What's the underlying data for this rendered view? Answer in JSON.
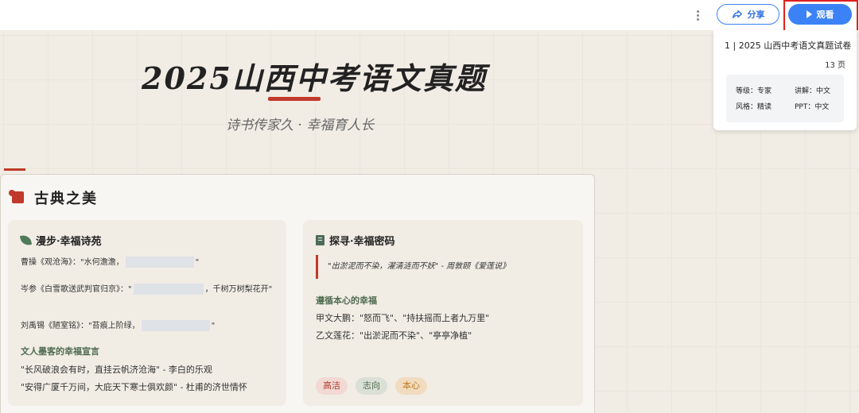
{
  "toolbar": {
    "more_icon": "kebab-vertical-icon",
    "share_label": "分享",
    "share_icon": "share-arrow-icon",
    "watch_label": "观看",
    "watch_icon": "play-icon",
    "accent_color": "#3b82f6",
    "highlight_color": "#e02020"
  },
  "slide": {
    "title": "2025山西中考语文真题",
    "subtitle": "诗书传家久 · 幸福育人长",
    "section": {
      "icon": "scroll-icon",
      "title": "古典之美"
    },
    "left_panel": {
      "icon": "leaf-icon",
      "title": "漫步·幸福诗苑",
      "poems": [
        {
          "before": "曹操《观沧海》：\"水何澹澹，",
          "after": "\""
        },
        {
          "before": "岑参《白雪歌送武判官归京》：\"",
          "after": "，千树万树梨花开\""
        },
        {
          "before": "刘禹锡《陋室铭》：\"苔痕上阶绿，",
          "after": "\""
        }
      ],
      "subheading": "文人墨客的幸福宣言",
      "lines": [
        "\"长风破浪会有时，直挂云帆济沧海\" - 李白的乐观",
        "\"安得广厦千万间，大庇天下寒士俱欢颜\" - 杜甫的济世情怀"
      ]
    },
    "right_panel": {
      "icon": "book-icon",
      "title": "探寻·幸福密码",
      "quote": "\"出淤泥而不染，濯清涟而不妖\" - 周敦颐《爱莲说》",
      "subheading": "遵循本心的幸福",
      "lines": [
        "甲文大鹏：\"怒而飞\"、\"持扶摇而上者九万里\"",
        "乙文莲花：\"出淤泥而不染\"、\"亭亭净植\""
      ],
      "tags": [
        "高洁",
        "志向",
        "本心"
      ]
    }
  },
  "info_panel": {
    "doc_title": "1 | 2025 山西中考语文真题试卷",
    "page_count": "13 页",
    "meta": {
      "level": "等级：专家",
      "lecture": "讲解：中文",
      "style": "风格：精读",
      "ppt": "PPT：中文"
    }
  }
}
